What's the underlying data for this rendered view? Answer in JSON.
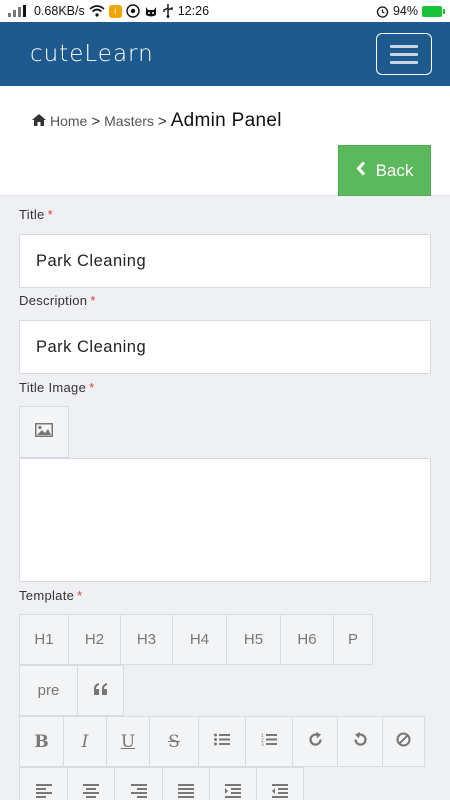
{
  "status_bar": {
    "signal_text": "0.68KB/s",
    "time": "12:26",
    "battery": "94%"
  },
  "header": {
    "brand": "cuteLearn",
    "menu_icon": "hamburger-icon"
  },
  "breadcrumb": {
    "home_icon": "home-icon",
    "home": "Home",
    "masters": "Masters",
    "current": "Admin Panel",
    "separator": ">"
  },
  "back_button": {
    "label": "Back",
    "icon": "chevron-left-icon"
  },
  "form": {
    "title": {
      "label": "Title",
      "required": "*",
      "value": "Park Cleaning"
    },
    "description": {
      "label": "Description",
      "required": "*",
      "value": "Park Cleaning"
    },
    "title_image": {
      "label": "Title Image",
      "required": "*",
      "icon": "image-icon"
    },
    "template": {
      "label": "Template",
      "required": "*"
    }
  },
  "toolbar": {
    "headings": [
      "H1",
      "H2",
      "H3",
      "H4",
      "H5",
      "H6",
      "P"
    ],
    "row2": [
      "pre",
      "quote-icon"
    ],
    "formatting": [
      "bold-icon",
      "italic-icon",
      "underline-icon",
      "strikethrough-icon",
      "bullet-list-icon",
      "numbered-list-icon",
      "redo-icon",
      "undo-icon",
      "clear-icon"
    ],
    "alignment": [
      "align-left-icon",
      "align-center-icon",
      "align-right-icon",
      "align-justify-icon",
      "indent-icon",
      "outdent-icon"
    ]
  },
  "colors": {
    "header_bg": "#1f5a8e",
    "back_button_bg": "#5cb85c",
    "required_mark": "#e53935",
    "page_bg": "#eef0f4"
  }
}
